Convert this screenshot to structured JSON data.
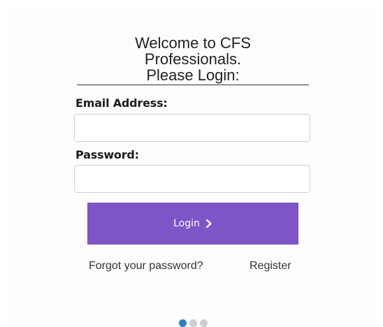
{
  "login": {
    "title_lines": [
      "Welcome to CFS",
      "Professionals.",
      "Please Login:"
    ],
    "email_label": "Email Address:",
    "email_value": "",
    "password_label": "Password:",
    "password_value": "",
    "login_button_label": "Login",
    "forgot_link": "Forgot your password?",
    "register_link": "Register"
  },
  "pager": {
    "total": 3,
    "active_index": 0
  },
  "colors": {
    "accent_button": "#7d55c7",
    "active_dot": "#2f7fc0",
    "inactive_dot": "#cfcfcf"
  },
  "icons": {
    "login_button_icon": "chevron-right-icon"
  }
}
